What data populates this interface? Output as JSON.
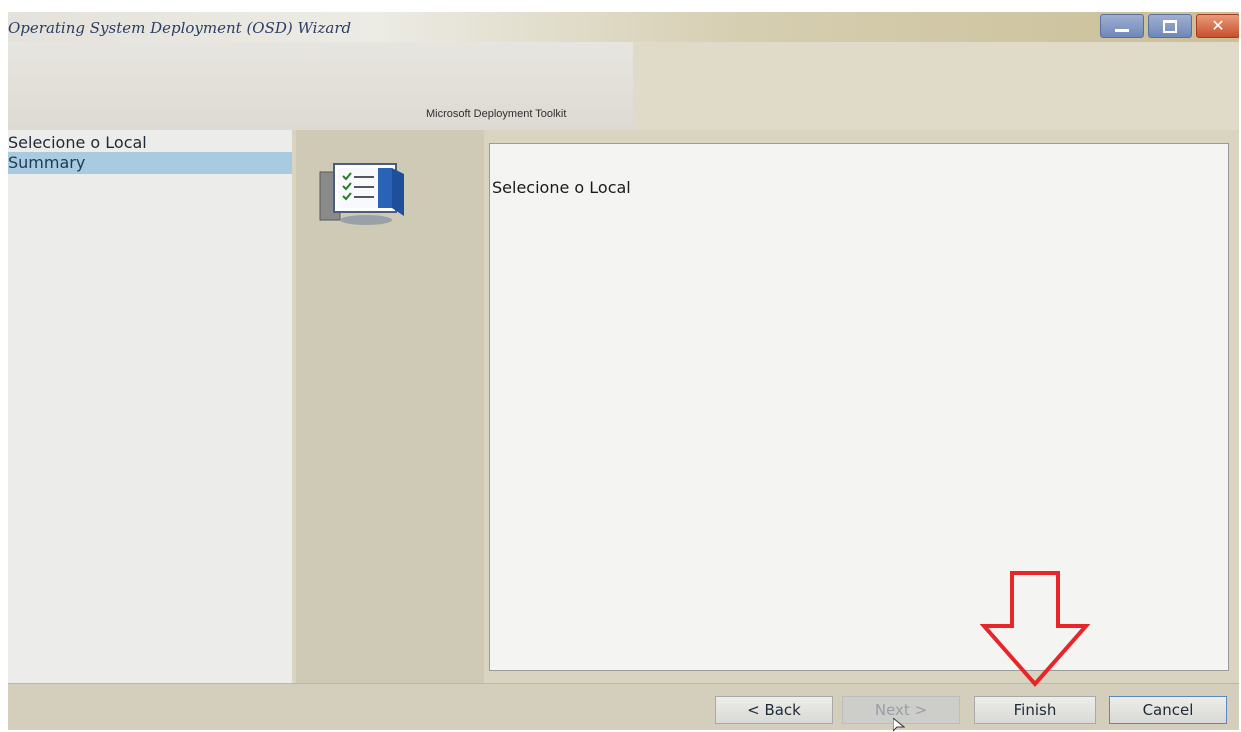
{
  "window": {
    "title": "Operating System Deployment (OSD) Wizard",
    "controls": {
      "minimize": "minimize-icon",
      "maximize": "maximize-icon",
      "close": "close-icon"
    }
  },
  "banner": {
    "toolkit_label": "Microsoft Deployment Toolkit"
  },
  "nav": {
    "items": [
      {
        "label": "Selecione o Local",
        "selected": false
      },
      {
        "label": "Summary",
        "selected": true
      }
    ]
  },
  "content": {
    "title": "Selecione o Local"
  },
  "buttons": {
    "back": "< Back",
    "next": "Next >",
    "finish": "Finish",
    "cancel": "Cancel"
  },
  "colors": {
    "selection": "#a8cbe0",
    "annotation_arrow": "#e8262a",
    "title_text": "#2c3e64"
  },
  "icons": {
    "page_icon": "checklist-monitor-icon",
    "annotation": "red-down-arrow-icon",
    "cursor": "mouse-pointer-icon"
  }
}
